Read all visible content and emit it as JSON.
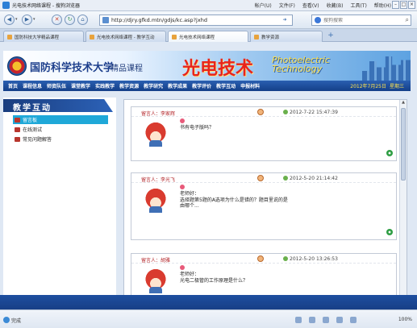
{
  "window": {
    "title": "光电技术网络课程 - 搜狗浏览器",
    "menus": [
      "帐户(U)",
      "文件(F)",
      "查看(V)",
      "收藏(B)",
      "工具(T)",
      "帮助(H)"
    ]
  },
  "toolbar": {
    "back": "◀",
    "forward": "▶",
    "stop": "✕",
    "refresh": "↻",
    "home": "⌂",
    "url": "http://djry.gfkd.mtn/gdjs/kc.asp?jxhd",
    "search_placeholder": "搜狗搜索"
  },
  "tabs": [
    {
      "label": "国防科技大学精品课程"
    },
    {
      "label": "光电技术网络课程 - 教学互动"
    },
    {
      "label": "光电技术网络课程"
    },
    {
      "label": "教学资源"
    }
  ],
  "banner": {
    "school": "国防科学技术大学",
    "course": "精品课程",
    "title": "光电技术",
    "english": "Photoelectric Technology"
  },
  "nav": {
    "items": [
      "首页",
      "课程信息",
      "师资队伍",
      "课堂教学",
      "实践教学",
      "教学资源",
      "教学研究",
      "教学成果",
      "教学评价",
      "教学互动",
      "申报材料"
    ],
    "date": "2012年7月25日",
    "weekday": "星期三"
  },
  "sidebar": {
    "heading": "教学互动",
    "items": [
      {
        "label": "留言板",
        "selected": true
      },
      {
        "label": "在线测试",
        "selected": false
      },
      {
        "label": "常见问题解答",
        "selected": false
      }
    ]
  },
  "posts": [
    {
      "author": "留言人：李家辉",
      "time": "2012-7-22 15:47:39",
      "body": "书有电子版吗？"
    },
    {
      "author": "留言人：李光飞",
      "time": "2012-5-20 21:14:42",
      "body": "老师好：\n选择题第5题的A选项为什么是错的？题目里说的是\n由哪个..."
    },
    {
      "author": "留言人：胡雅",
      "time": "2012-5-20 13:26:53",
      "body": "老师好：\n光电二极管的工作原理是什么？"
    }
  ],
  "status": {
    "text": "完成",
    "zoom": "100%"
  },
  "colors": {
    "nav_bg": "#143f88",
    "accent_red": "#e8241b",
    "selected_item": "#1fa8d8"
  }
}
